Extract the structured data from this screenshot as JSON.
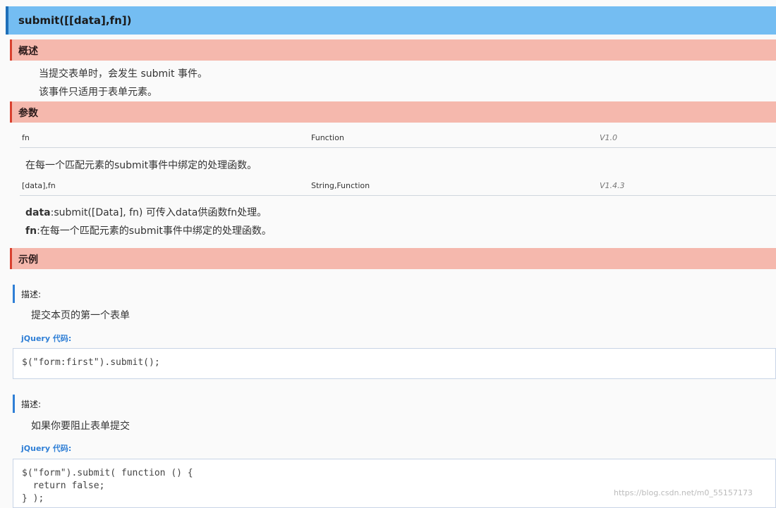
{
  "title": "submit([[data],fn])",
  "overview": {
    "heading": "概述",
    "lines": [
      "当提交表单时，会发生 submit 事件。",
      "该事件只适用于表单元素。"
    ]
  },
  "params": {
    "heading": "参数",
    "rows": [
      {
        "name": "fn",
        "type": "Function",
        "version": "V1.0",
        "desc": "在每一个匹配元素的submit事件中绑定的处理函数。"
      },
      {
        "name": "[data],fn",
        "type": "String,Function",
        "version": "V1.4.3"
      }
    ],
    "detail": [
      {
        "key": "data",
        "text": ":submit([Data], fn) 可传入data供函数fn处理。"
      },
      {
        "key": "fn",
        "text": ":在每一个匹配元素的submit事件中绑定的处理函数。"
      }
    ]
  },
  "examples": {
    "heading": "示例",
    "items": [
      {
        "desc_label": "描述:",
        "desc": "提交本页的第一个表单",
        "code_label": "jQuery 代码:",
        "code": "$(\"form:first\").submit();"
      },
      {
        "desc_label": "描述:",
        "desc": "如果你要阻止表单提交",
        "code_label": "jQuery 代码:",
        "code": "$(\"form\").submit( function () {\n  return false;\n} );"
      }
    ]
  },
  "watermark": "https://blog.csdn.net/m0_55157173",
  "colors": {
    "title_bg": "#74bdf2",
    "section_bg": "#f5b8ad",
    "accent_blue": "#2f7fd6",
    "accent_red": "#d9412f"
  }
}
